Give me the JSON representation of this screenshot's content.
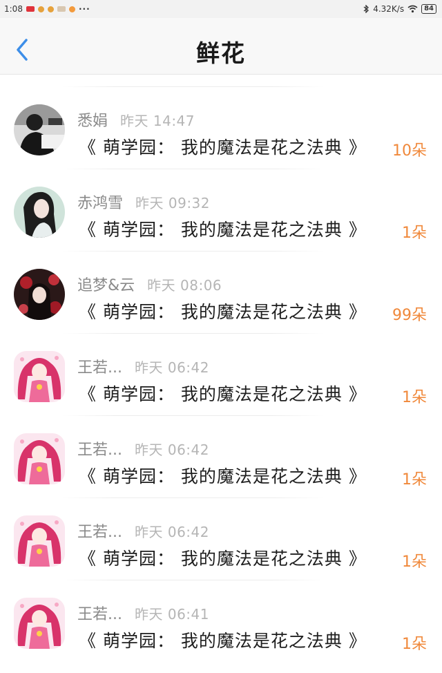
{
  "status_bar": {
    "time": "1:08",
    "more": "···",
    "network_speed": "4.32K/s",
    "battery": "84"
  },
  "header": {
    "title": "鲜花"
  },
  "colors": {
    "accent_orange": "#f0883a",
    "back_blue": "#3d8ee8"
  },
  "gifts": [
    {
      "user": "悉娟",
      "time": "昨天 14:47",
      "book": "《 萌学园： 我的魔法是花之法典 》",
      "amount": "10朵",
      "avatar": "avatar-photo-dark"
    },
    {
      "user": "赤鸿雪",
      "time": "昨天 09:32",
      "book": "《 萌学园： 我的魔法是花之法典 》",
      "amount": "1朵",
      "avatar": "avatar-girl"
    },
    {
      "user": "追梦&云",
      "time": "昨天 08:06",
      "book": "《 萌学园： 我的魔法是花之法典 》",
      "amount": "99朵",
      "avatar": "avatar-anime-dark"
    },
    {
      "user": "王若...",
      "time": "昨天 06:42",
      "book": "《 萌学园： 我的魔法是花之法典 》",
      "amount": "1朵",
      "avatar": "avatar-anime-pink"
    },
    {
      "user": "王若...",
      "time": "昨天 06:42",
      "book": "《 萌学园： 我的魔法是花之法典 》",
      "amount": "1朵",
      "avatar": "avatar-anime-pink"
    },
    {
      "user": "王若...",
      "time": "昨天 06:42",
      "book": "《 萌学园： 我的魔法是花之法典 》",
      "amount": "1朵",
      "avatar": "avatar-anime-pink"
    },
    {
      "user": "王若...",
      "time": "昨天 06:41",
      "book": "《 萌学园： 我的魔法是花之法典 》",
      "amount": "1朵",
      "avatar": "avatar-anime-pink"
    }
  ]
}
